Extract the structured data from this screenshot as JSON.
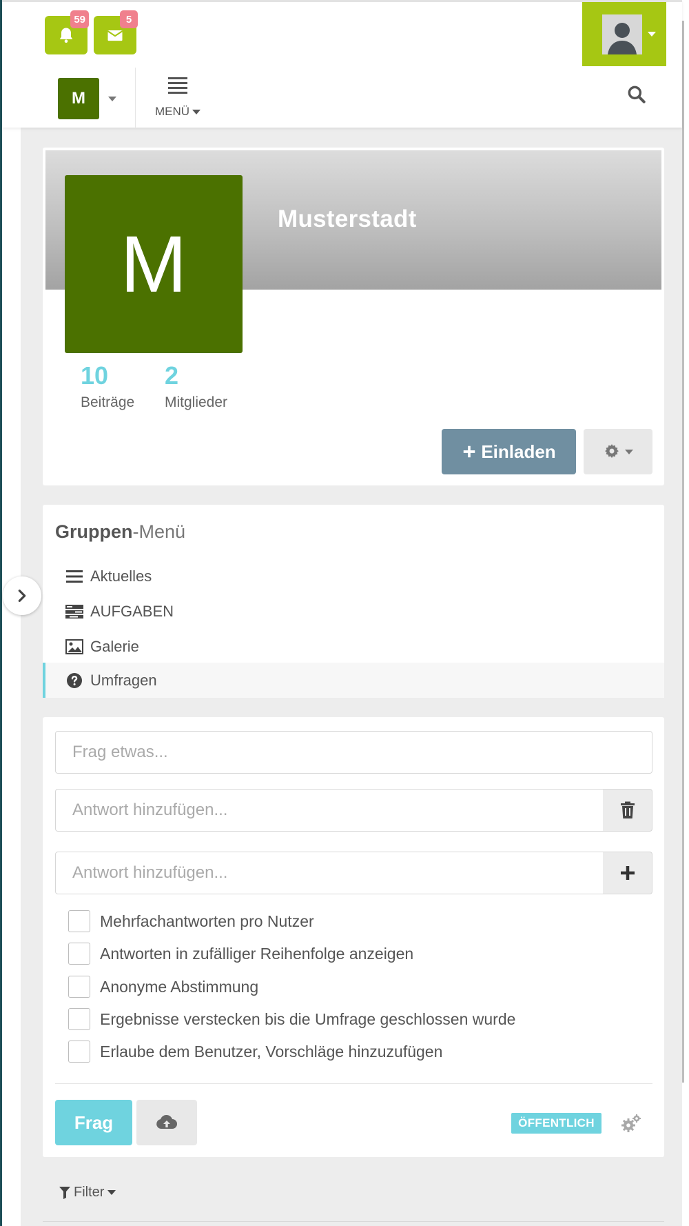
{
  "topbar": {
    "notifications": {
      "icon": "bell-icon",
      "count": "59"
    },
    "messages": {
      "icon": "envelope-icon",
      "count": "5"
    },
    "user_menu": {
      "avatar": "user-silhouette-icon"
    },
    "space_chooser": {
      "initial": "M"
    },
    "menu_label": "MENÜ",
    "search_icon": "search-icon"
  },
  "space": {
    "title": "Musterstadt",
    "logo_initial": "M",
    "stats": [
      {
        "value": "10",
        "label": "Beiträge"
      },
      {
        "value": "2",
        "label": "Mitglieder"
      }
    ],
    "invite_label": "Einladen",
    "settings_icon": "gear-icon"
  },
  "group_menu": {
    "title_bold": "Gruppen",
    "title_light": "-Menü",
    "items": [
      {
        "label": "Aktuelles",
        "icon": "list-icon"
      },
      {
        "label": "AUFGABEN",
        "icon": "tasks-icon"
      },
      {
        "label": "Galerie",
        "icon": "image-icon"
      },
      {
        "label": "Umfragen",
        "icon": "question-circle-icon",
        "active": true
      }
    ]
  },
  "poll_form": {
    "question_placeholder": "Frag etwas...",
    "answers": [
      {
        "placeholder": "Antwort hinzufügen...",
        "action_icon": "trash-icon"
      },
      {
        "placeholder": "Antwort hinzufügen...",
        "action_icon": "plus-icon"
      }
    ],
    "options": [
      "Mehrfachantworten pro Nutzer",
      "Antworten in zufälliger Reihenfolge anzeigen",
      "Anonyme Abstimmung",
      "Ergebnisse verstecken bis die Umfrage geschlossen wurde",
      "Erlaube dem Benutzer, Vorschläge hinzuzufügen"
    ],
    "submit_label": "Frag",
    "upload_icon": "cloud-upload-icon",
    "visibility_label": "ÖFFENTLICH",
    "settings_icon": "cogs-icon"
  },
  "filter": {
    "label": "Filter",
    "icon": "filter-icon"
  },
  "colors": {
    "accent_green": "#a6c713",
    "space_green": "#4b7100",
    "info_cyan": "#6fd3df",
    "badge_pink": "#f0808d",
    "invite_slate": "#708fa1"
  }
}
